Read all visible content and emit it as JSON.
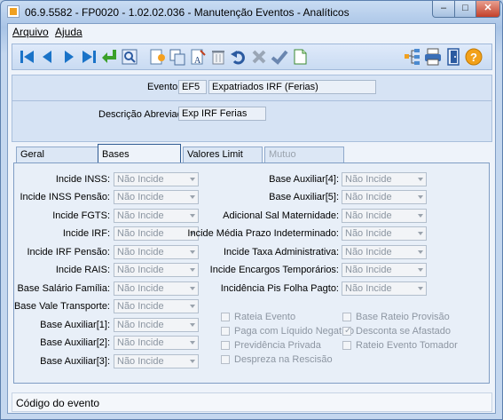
{
  "window": {
    "title": "06.9.5582 - FP0020 - 1.02.02.036 - Manutenção Eventos - Analíticos"
  },
  "menu": {
    "arquivo": "Arquivo",
    "ajuda": "Ajuda"
  },
  "toolbar": {
    "icons": [
      "first-record",
      "previous-record",
      "next-record",
      "last-record",
      "confirm",
      "search",
      "new",
      "copy",
      "edit",
      "delete",
      "undo",
      "cancel",
      "ok",
      "document",
      "tree",
      "print",
      "exit",
      "help"
    ]
  },
  "evento": {
    "label": "Evento:",
    "code": "EF5",
    "name": "Expatriados IRF (Ferias)"
  },
  "descricao": {
    "label": "Descrição Abreviada:",
    "value": "Exp IRF Ferias"
  },
  "tabs": [
    "Geral",
    "Bases",
    "Valores Limit",
    "Mutuo"
  ],
  "left_fields": [
    {
      "label": "Incide INSS:",
      "value": "Não Incide"
    },
    {
      "label": "Incide INSS Pensão:",
      "value": "Não Incide"
    },
    {
      "label": "Incide FGTS:",
      "value": "Não Incide"
    },
    {
      "label": "Incide IRF:",
      "value": "Não Incide"
    },
    {
      "label": "Incide IRF Pensão:",
      "value": "Não Incide"
    },
    {
      "label": "Incide RAIS:",
      "value": "Não Incide"
    },
    {
      "label": "Base Salário Família:",
      "value": "Não Incide"
    },
    {
      "label": "Base Vale Transporte:",
      "value": "Não Incide"
    },
    {
      "label": "Base Auxiliar[1]:",
      "value": "Não Incide"
    },
    {
      "label": "Base Auxiliar[2]:",
      "value": "Não Incide"
    },
    {
      "label": "Base Auxiliar[3]:",
      "value": "Não Incide"
    }
  ],
  "right_fields": [
    {
      "label": "Base Auxiliar[4]:",
      "value": "Não Incide"
    },
    {
      "label": "Base Auxiliar[5]:",
      "value": "Não Incide"
    },
    {
      "label": "Adicional Sal Maternidade:",
      "value": "Não Incide"
    },
    {
      "label": "Incide Média Prazo Indeterminado:",
      "value": "Não Incide"
    },
    {
      "label": "Incide Taxa Administrativa:",
      "value": "Não Incide"
    },
    {
      "label": "Incide Encargos Temporários:",
      "value": "Não Incide"
    },
    {
      "label": "Incidência Pis Folha Pagto:",
      "value": "Não Incide"
    }
  ],
  "checkboxes_left": [
    {
      "label": "Rateia Evento",
      "checked": false
    },
    {
      "label": "Paga com Líquido Negativo",
      "checked": false
    },
    {
      "label": "Previdência Privada",
      "checked": false
    },
    {
      "label": "Despreza na Rescisão",
      "checked": false
    }
  ],
  "checkboxes_right": [
    {
      "label": "Base Rateio Provisão",
      "checked": false
    },
    {
      "label": "Desconta se Afastado",
      "checked": true
    },
    {
      "label": "Rateio Evento Tomador",
      "checked": false
    }
  ],
  "status": {
    "text": "Código do evento"
  }
}
